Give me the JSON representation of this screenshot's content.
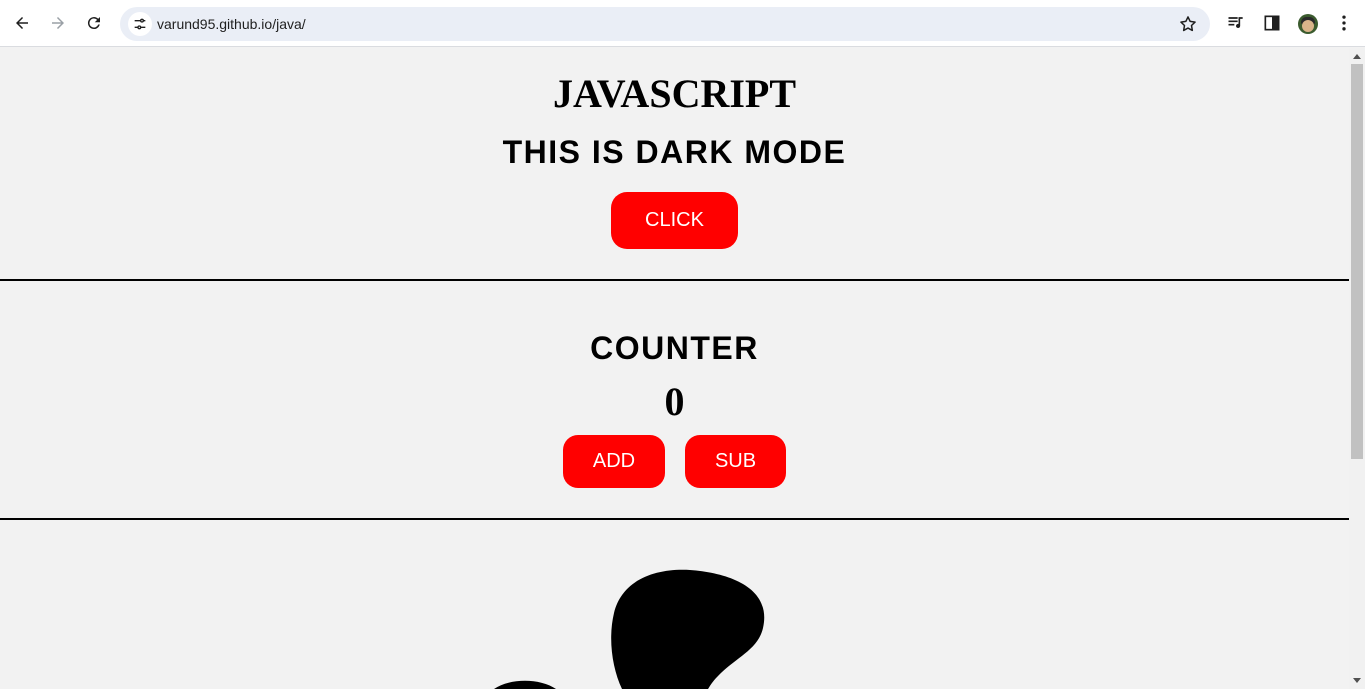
{
  "browser": {
    "url": "varund95.github.io/java/",
    "icons": {
      "back": "arrow-left-icon",
      "forward": "arrow-right-icon",
      "reload": "reload-icon",
      "site_info": "tune-icon",
      "bookmark": "star-icon",
      "media": "playlist-icon",
      "side_panel": "side-panel-icon",
      "profile": "avatar",
      "menu": "kebab-menu-icon"
    }
  },
  "page": {
    "title": "JAVASCRIPT",
    "mode_heading": "THIS IS DARK MODE",
    "click_label": "CLICK",
    "counter_heading": "COUNTER",
    "counter_value": "0",
    "add_label": "ADD",
    "sub_label": "SUB"
  },
  "colors": {
    "background": "#f2f2f2",
    "button": "#ff0000",
    "button_text": "#ffffff",
    "text": "#000000"
  }
}
